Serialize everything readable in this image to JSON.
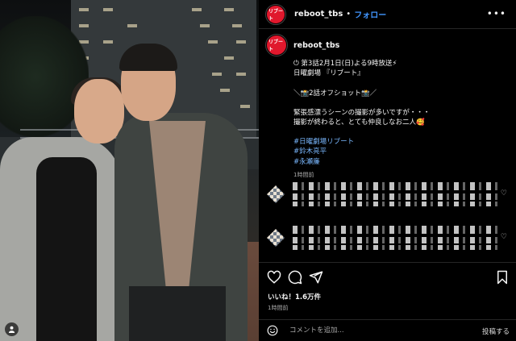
{
  "post": {
    "username": "reboot_tbs",
    "follow_separator": "•",
    "follow_label": "フォロー",
    "more_label": "•••",
    "avatar_text": "リブート"
  },
  "caption": {
    "username": "reboot_tbs",
    "lines": [
      "⏻ 第3話2月1日(日)よる9時放送⚡",
      "日曜劇場 『リブート』",
      "＼📸2話オフショット📸／",
      "緊張感漂うシーンの撮影が多いですが・・・",
      "撮影が終わると、とても仲良しなお二人🥰"
    ],
    "hashtags": [
      "#日曜劇場リブート",
      "#鈴木亮平",
      "#永瀬廉"
    ],
    "time": "1時間前"
  },
  "icons": {
    "heart": "heart-icon",
    "comment": "comment-icon",
    "share": "share-icon",
    "save": "bookmark-icon",
    "emoji": "emoji-icon",
    "user": "user-icon",
    "more": "more-horizontal-icon"
  },
  "likes_text": "いいね！1.6万件",
  "post_time": "1時間前",
  "comment_input": {
    "placeholder": "コメントを追加...",
    "post_label": "投稿する"
  },
  "colors": {
    "accent_link": "#4196ff",
    "hashtag": "#7ab8ff",
    "brand_red": "#e0182d",
    "background": "#000000"
  }
}
